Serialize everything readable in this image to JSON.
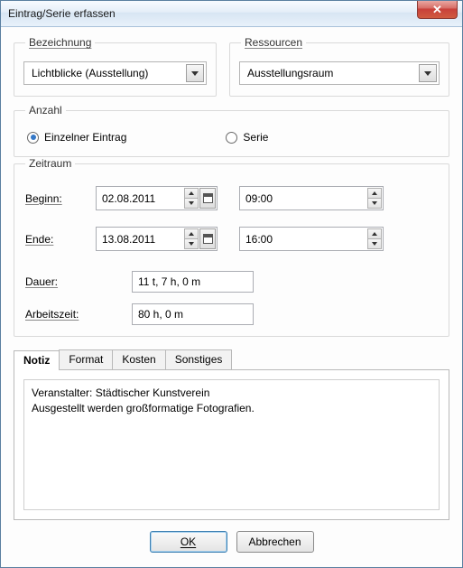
{
  "window": {
    "title": "Eintrag/Serie erfassen"
  },
  "designation": {
    "legend": "Bezeichnung",
    "value": "Lichtblicke (Ausstellung)"
  },
  "resources": {
    "legend": "Ressourcen",
    "value": "Ausstellungsraum"
  },
  "count": {
    "legend": "Anzahl",
    "single_label": "Einzelner Eintrag",
    "series_label": "Serie",
    "selected": "single"
  },
  "period": {
    "legend": "Zeitraum",
    "begin_label": "Beginn:",
    "end_label": "Ende:",
    "begin_date": "02.08.2011",
    "begin_time": "09:00",
    "end_date": "13.08.2011",
    "end_time": "16:00",
    "duration_label": "Dauer:",
    "duration_value": "11 t, 7 h, 0 m",
    "work_label": "Arbeitszeit:",
    "work_value": "80 h, 0 m"
  },
  "tabs": {
    "notiz": "Notiz",
    "format": "Format",
    "kosten": "Kosten",
    "sonstiges": "Sonstiges",
    "active": "notiz",
    "notes_text": "Veranstalter: Städtischer Kunstverein\nAusgestellt werden großformatige Fotografien."
  },
  "buttons": {
    "ok": "OK",
    "cancel": "Abbrechen"
  }
}
